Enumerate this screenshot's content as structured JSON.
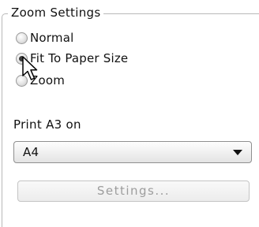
{
  "zoom_settings": {
    "title": "Zoom Settings",
    "options": [
      {
        "label": "Normal",
        "checked": false
      },
      {
        "label": "Fit To Paper Size",
        "checked": true
      },
      {
        "label": "Zoom",
        "checked": false
      }
    ]
  },
  "print_a3": {
    "label": "Print A3 on",
    "selected": "A4"
  },
  "settings_button": {
    "label": "Settings..."
  },
  "icons": {
    "cursor": "arrow-pointer-icon",
    "dropdown": "chevron-down-icon"
  }
}
